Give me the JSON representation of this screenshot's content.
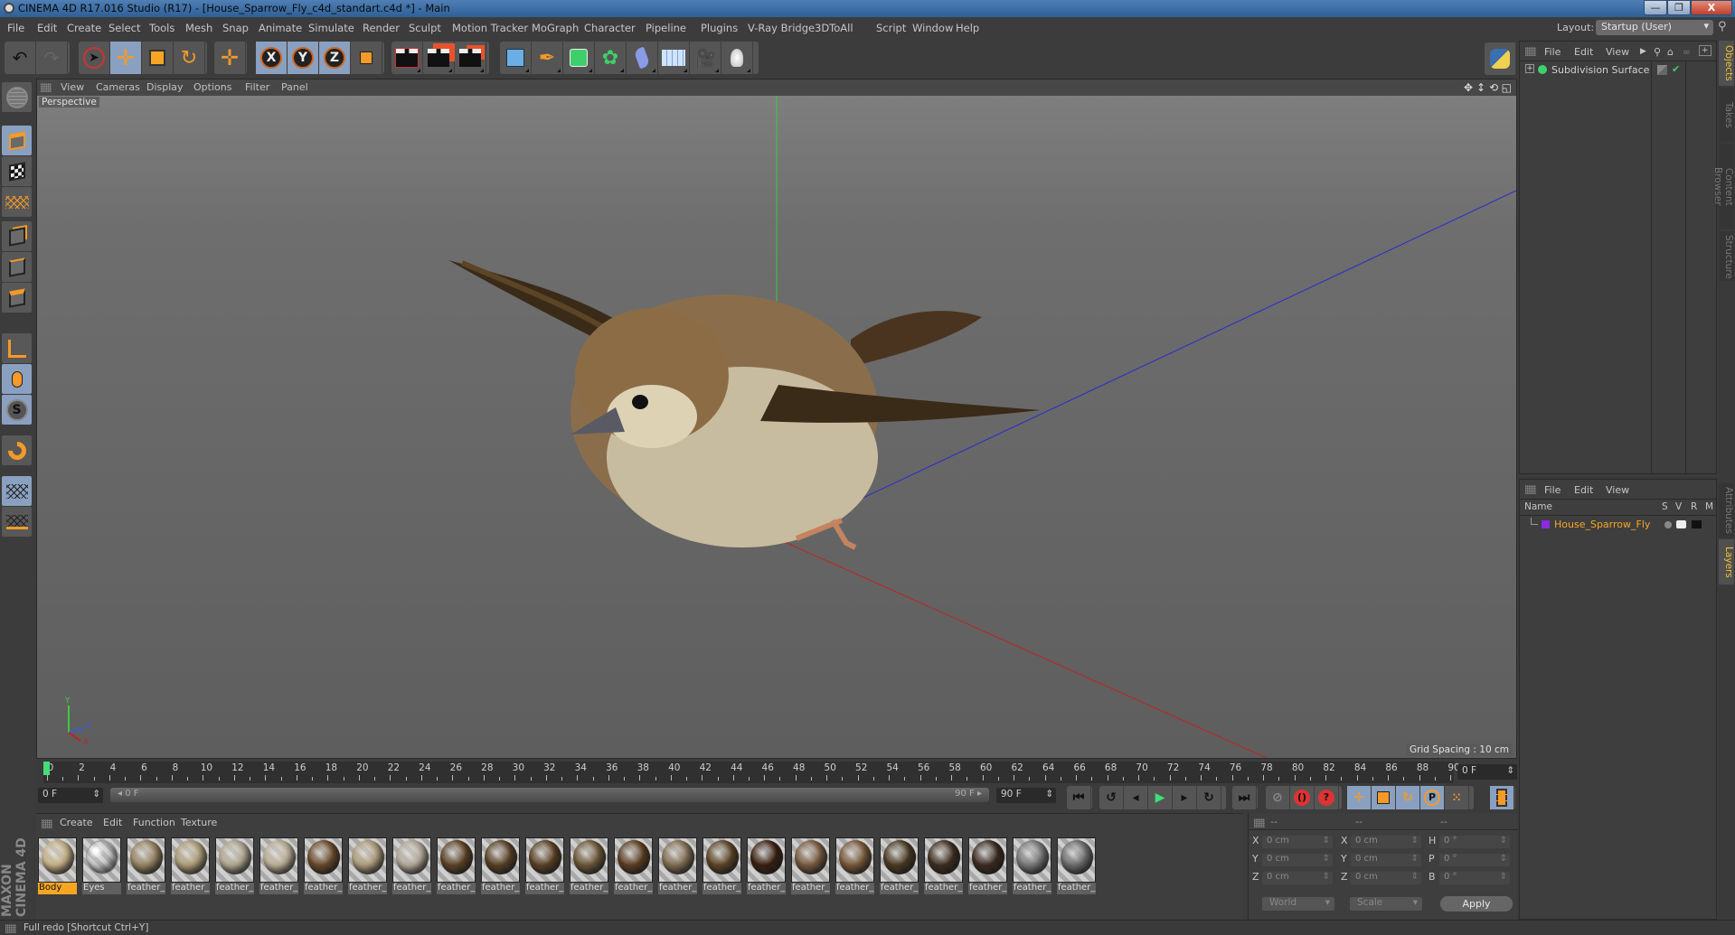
{
  "window": {
    "title": "CINEMA 4D R17.016 Studio (R17) - [House_Sparrow_Fly_c4d_standart.c4d *] - Main",
    "minimize_icon": "minimize-icon",
    "maximize_icon": "restore-icon",
    "close_icon": "close-icon",
    "minimize_glyph": "—",
    "restore_glyph": "❐",
    "close_glyph": "X"
  },
  "menubar": {
    "items": [
      "File",
      "Edit",
      "Create",
      "Select",
      "Tools",
      "Mesh",
      "Snap",
      "Animate",
      "Simulate",
      "Render",
      "Sculpt",
      "Motion Tracker",
      "MoGraph",
      "Character",
      "Pipeline",
      "Plugins",
      "V-Ray Bridge",
      "3DToAll",
      "Script",
      "Window",
      "Help"
    ],
    "layout_label": "Layout:",
    "layout_value": "Startup (User)"
  },
  "toolbar": {
    "groups": [
      {
        "buttons": [
          "undo",
          "redo"
        ]
      },
      {
        "buttons": [
          "live-selection",
          "move",
          "scale",
          "rotate"
        ]
      },
      {
        "buttons": [
          "last-tool"
        ]
      },
      {
        "buttons": [
          "x-axis-lock",
          "y-axis-lock",
          "z-axis-lock",
          "coordinate-system"
        ]
      },
      {
        "buttons": [
          "render-view",
          "render-to-picture-viewer",
          "render-settings"
        ]
      },
      {
        "buttons": [
          "cube",
          "pen",
          "subdivision-surface",
          "cloner",
          "bend-deformer",
          "floor",
          "camera",
          "light"
        ]
      }
    ],
    "axis_labels": [
      "X",
      "Y",
      "Z"
    ]
  },
  "left_tools": [
    "make-editable",
    "model-mode",
    "texture-mode",
    "workplane-mode",
    "points-mode",
    "edges-mode",
    "polygons-mode",
    "axis-mode",
    "tweak-mode",
    "solo-mode",
    "snapping",
    "locked-workplane",
    "planar-workplane"
  ],
  "viewport": {
    "menu": [
      "View",
      "Cameras",
      "Display",
      "Options",
      "Filter",
      "Panel"
    ],
    "camera_label": "Perspective",
    "grid_spacing": "Grid Spacing : 10 cm",
    "axis_y": "Y",
    "axis_x": "X",
    "axis_z": "Z",
    "nav_icons": [
      "move-view",
      "dolly-view",
      "rotate-view",
      "toggle-view"
    ]
  },
  "timeline": {
    "start": 0,
    "end": 90,
    "step": 2,
    "current_frame": "0 F",
    "current_field": "0 F",
    "range_start": "0 F",
    "range_end_slider": "90 F",
    "range_end": "90 F",
    "playback_buttons": [
      "go-to-start",
      "previous-key",
      "previous-frame",
      "play",
      "next-frame",
      "next-key",
      "go-to-end"
    ],
    "record_buttons": [
      "record-active-objects",
      "autokeying",
      "keyframe-selection"
    ],
    "key_buttons": [
      "position-key",
      "scale-key",
      "rotation-key",
      "parameter-key",
      "point-level-key",
      "timeline-window"
    ]
  },
  "materials": {
    "menu": [
      "Create",
      "Edit",
      "Function",
      "Texture"
    ],
    "items": [
      {
        "name": "Body",
        "color": "#c9b48a",
        "selected": true
      },
      {
        "name": "Eyes",
        "color": "#d9d9d9",
        "selected": false
      },
      {
        "name": "feather_",
        "color": "#9a8664"
      },
      {
        "name": "feather_",
        "color": "#b2a07c"
      },
      {
        "name": "feather_",
        "color": "#b4aa94"
      },
      {
        "name": "feather_",
        "color": "#bfb29a"
      },
      {
        "name": "feather_",
        "color": "#6b4a2a"
      },
      {
        "name": "feather_",
        "color": "#b19f7f"
      },
      {
        "name": "feather_",
        "color": "#b6ad9c"
      },
      {
        "name": "feather_",
        "color": "#5e4326"
      },
      {
        "name": "feather_",
        "color": "#5a4126"
      },
      {
        "name": "feather_",
        "color": "#5c4224"
      },
      {
        "name": "feather_",
        "color": "#6e5838"
      },
      {
        "name": "feather_",
        "color": "#5d3f22"
      },
      {
        "name": "feather_",
        "color": "#857053"
      },
      {
        "name": "feather_",
        "color": "#5e4426"
      },
      {
        "name": "feather_",
        "color": "#3a1f10"
      },
      {
        "name": "feather_",
        "color": "#7a5c40"
      },
      {
        "name": "feather_",
        "color": "#7a5a3a"
      },
      {
        "name": "feather_",
        "color": "#4a3a22"
      },
      {
        "name": "feather_",
        "color": "#3e2e20"
      },
      {
        "name": "feather_",
        "color": "#3c2a20"
      },
      {
        "name": "feather_",
        "color": "#7a7a7a"
      },
      {
        "name": "feather_",
        "color": "#6e6e6e"
      }
    ]
  },
  "coordinates": {
    "header": [
      "--",
      "--",
      "--"
    ],
    "rows": [
      {
        "pos_label": "X",
        "pos": "0 cm",
        "size_label": "X",
        "size": "0 cm",
        "rot_label": "H",
        "rot": "0 °"
      },
      {
        "pos_label": "Y",
        "pos": "0 cm",
        "size_label": "Y",
        "size": "0 cm",
        "rot_label": "P",
        "rot": "0 °"
      },
      {
        "pos_label": "Z",
        "pos": "0 cm",
        "size_label": "Z",
        "size": "0 cm",
        "rot_label": "B",
        "rot": "0 °"
      }
    ],
    "space_select": "World",
    "mode_select": "Scale",
    "apply_label": "Apply"
  },
  "objects_panel": {
    "menu": [
      "File",
      "Edit",
      "View"
    ],
    "items": [
      {
        "name": "Subdivision Surface",
        "expand": "+",
        "color": "#3fcf6a"
      }
    ]
  },
  "layers_panel": {
    "menu": [
      "File",
      "Edit",
      "View"
    ],
    "columns": [
      "Name",
      "S",
      "V",
      "R",
      "M"
    ],
    "items": [
      {
        "name": "House_Sparrow_Fly",
        "color": "#8a2be2"
      }
    ]
  },
  "side_tabs": [
    "Objects",
    "Takes",
    "Content Browser",
    "Structure",
    "Attributes",
    "Layers"
  ],
  "status": {
    "text": "Full redo [Shortcut Ctrl+Y]"
  },
  "branding": {
    "logo": "MAXON CINEMA 4D"
  }
}
